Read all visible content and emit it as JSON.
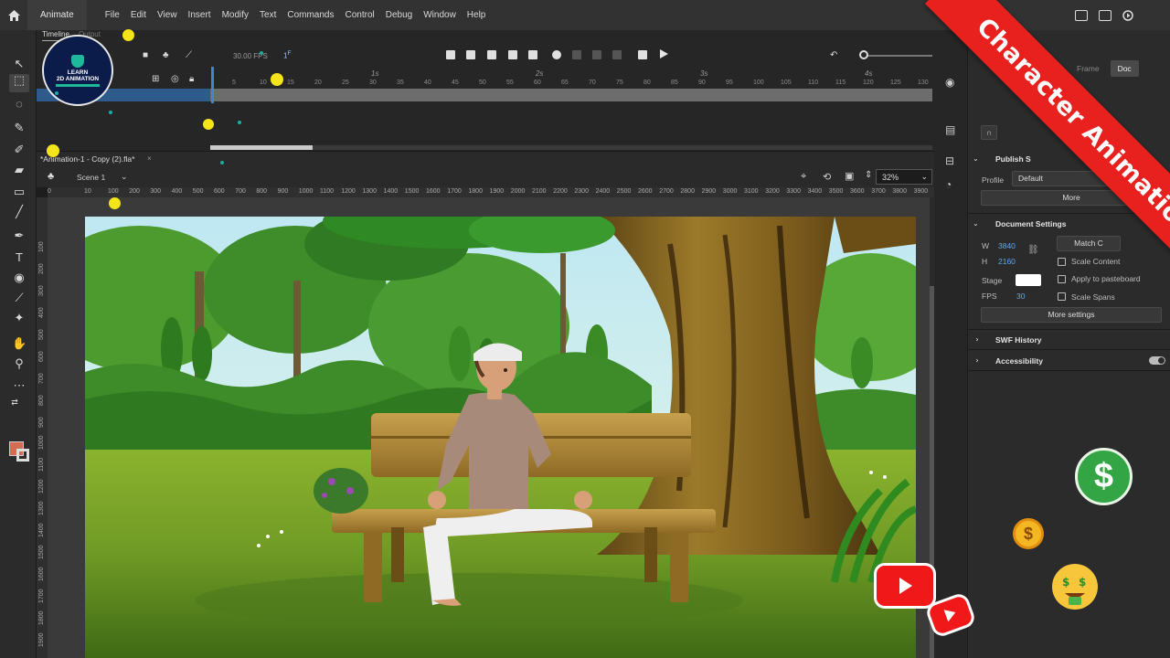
{
  "menu": {
    "app_tab": "Animate",
    "items": [
      "File",
      "Edit",
      "View",
      "Insert",
      "Modify",
      "Text",
      "Commands",
      "Control",
      "Debug",
      "Window",
      "Help"
    ]
  },
  "timeline": {
    "tab_timeline": "Timeline",
    "tab_output": "Output",
    "fps": "30.00",
    "fps_unit": "FPS",
    "frame": "1",
    "frame_unit": "F",
    "seconds": [
      "1s",
      "2s",
      "3s",
      "4s"
    ],
    "frame_numbers": [
      "5",
      "10",
      "15",
      "20",
      "25",
      "30",
      "35",
      "40",
      "45",
      "50",
      "55",
      "60",
      "65",
      "70",
      "75",
      "80",
      "85",
      "90",
      "95",
      "100",
      "105",
      "110",
      "115",
      "120",
      "125",
      "130"
    ]
  },
  "logo": {
    "line1": "LEARN",
    "line2": "2D ANIMATION"
  },
  "document": {
    "tab_title": "*Animation-1 - Copy (2).fla*",
    "scene": "Scene 1",
    "zoom": "32%"
  },
  "rulers": {
    "h": [
      "0",
      "10",
      "100",
      "200",
      "300",
      "400",
      "500",
      "600",
      "700",
      "800",
      "900",
      "1000",
      "1100",
      "1200",
      "1300",
      "1400",
      "1500",
      "1600",
      "1700",
      "1800",
      "1900",
      "2000",
      "2100",
      "2200",
      "2300",
      "2400",
      "2500",
      "2600",
      "2700",
      "2800",
      "2900",
      "3000",
      "3100",
      "3200",
      "3300",
      "3400",
      "3500",
      "3600",
      "3700",
      "3800",
      "3900"
    ],
    "v": [
      "100",
      "200",
      "300",
      "400",
      "500",
      "600",
      "700",
      "800",
      "900",
      "1000",
      "1100",
      "1200",
      "1300",
      "1400",
      "1500",
      "1600",
      "1700",
      "1800",
      "1900"
    ]
  },
  "panel": {
    "tab_frame": "Frame",
    "tab_doc": "Doc",
    "publish_settings": "Publish S",
    "profile_label": "Profile",
    "profile_value": "Default",
    "more_btn": "More",
    "document_settings": "Document Settings",
    "w_label": "W",
    "w_value": "3840",
    "h_label": "H",
    "h_value": "2160",
    "match_btn": "Match C",
    "scale_content": "Scale Content",
    "stage_label": "Stage",
    "apply_pasteboard": "Apply to pasteboard",
    "fps_label": "FPS",
    "fps_value": "30",
    "scale_spans": "Scale Spans",
    "more_settings": "More settings",
    "swf_history": "SWF History",
    "accessibility": "Accessibility"
  },
  "banner": {
    "text": "Character Animation"
  },
  "colors": {
    "accent_blue": "#3d86d6",
    "banner_red": "#e8211e",
    "fill_swatch": "#d46b53"
  }
}
